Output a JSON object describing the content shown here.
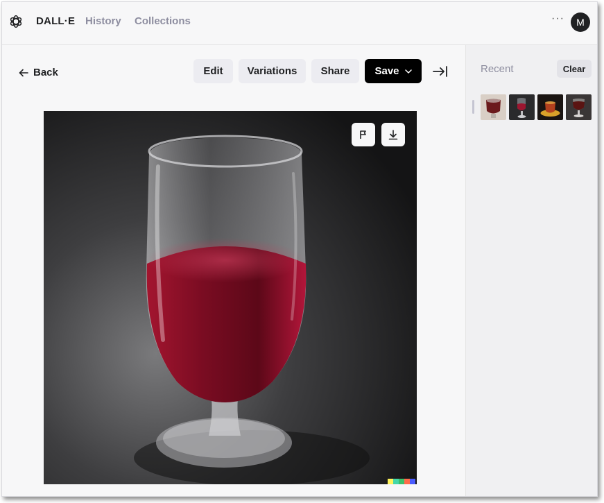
{
  "app": {
    "brand": "DALL·E",
    "nav": {
      "history": "History",
      "collections": "Collections"
    },
    "more": "···",
    "avatar_initial": "M"
  },
  "toolbar": {
    "back": "Back",
    "edit": "Edit",
    "variations": "Variations",
    "share": "Share",
    "save": "Save"
  },
  "image": {
    "signature_colors": [
      "#fff35c",
      "#44d7a8",
      "#3ac06a",
      "#ff6b4a",
      "#4a5cff"
    ]
  },
  "sidebar": {
    "recent_label": "Recent",
    "clear_label": "Clear",
    "thumbnail_count": 4
  },
  "colors": {
    "accent_black": "#000000",
    "wine": "#8b0f2a",
    "button_bg": "#ececf1"
  }
}
